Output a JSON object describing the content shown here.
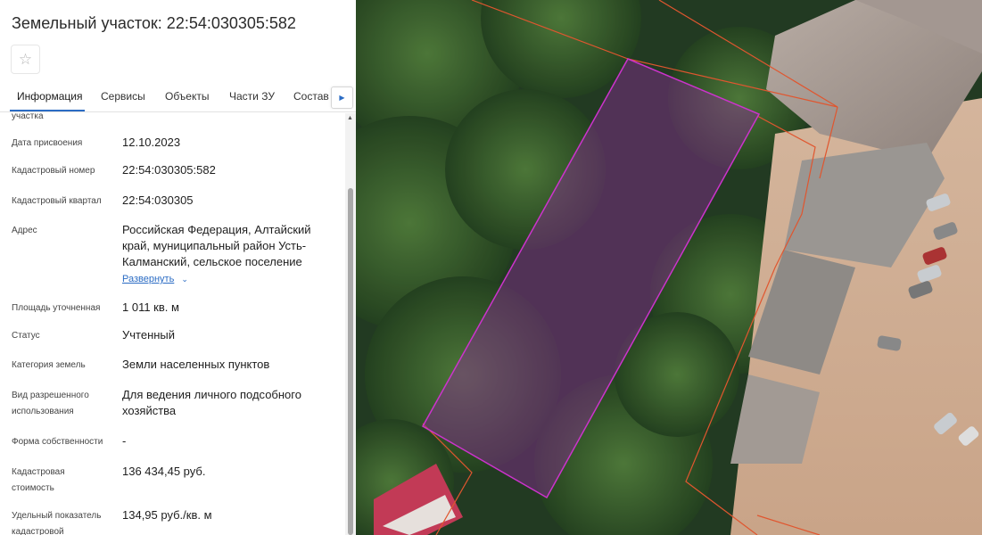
{
  "panel": {
    "title": "Земельный участок: 22:54:030305:582",
    "favorite_icon": "star-outline-icon",
    "tabs": [
      {
        "label": "Информация",
        "active": true
      },
      {
        "label": "Сервисы",
        "active": false
      },
      {
        "label": "Объекты",
        "active": false
      },
      {
        "label": "Части ЗУ",
        "active": false
      },
      {
        "label": "Состав",
        "active": false
      }
    ],
    "tabs_next_icon": "triangle-right-icon",
    "cut_label": "участка",
    "rows": [
      {
        "label": "Дата присвоения",
        "value": "12.10.2023"
      },
      {
        "label": "Кадастровый номер",
        "value": "22:54:030305:582"
      },
      {
        "label": "Кадастровый квартал",
        "value": "22:54:030305"
      },
      {
        "label": "Адрес",
        "value": "Российская Федерация, Алтайский край, муниципальный район Усть-Калманский, сельское поселение"
      },
      {
        "label": "Площадь уточненная",
        "value": "1 011 кв. м"
      },
      {
        "label": "Статус",
        "value": "Учтенный"
      },
      {
        "label": "Категория земель",
        "value": "Земли населенных пунктов"
      },
      {
        "label": "Вид разрешенного использования",
        "value": "Для ведения личного подсобного хозяйства"
      },
      {
        "label": "Форма собственности",
        "value": "-"
      },
      {
        "label": "Кадастровая стоимость",
        "value": "136 434,45 руб."
      },
      {
        "label": "Удельный показатель кадастровой",
        "value": "134,95 руб./кв. м"
      }
    ],
    "expand_link": "Развернуть",
    "expand_icon": "chevron-down-icon"
  },
  "map": {
    "parcel_fill": "#8c2a96",
    "parcel_outline": "#cc33cc",
    "boundary_color": "#e0562f"
  }
}
